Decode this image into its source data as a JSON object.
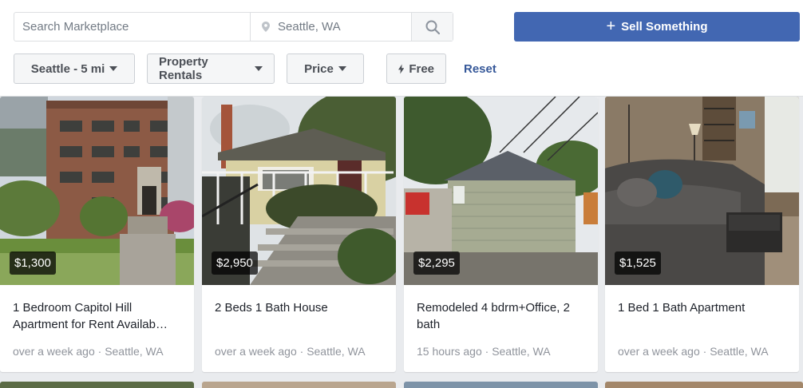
{
  "search": {
    "placeholder": "Search Marketplace",
    "location": "Seattle, WA"
  },
  "sell_button": "Sell Something",
  "filters": {
    "radius": "Seattle - 5 mi",
    "category": "Property Rentals",
    "price": "Price",
    "free": "Free",
    "reset": "Reset"
  },
  "listings": [
    {
      "price": "$1,300",
      "title": "1 Bedroom Capitol Hill Apartment for Rent Availab…",
      "time": "over a week ago",
      "location": "Seattle, WA"
    },
    {
      "price": "$2,950",
      "title": "2 Beds 1 Bath House",
      "time": "over a week ago",
      "location": "Seattle, WA"
    },
    {
      "price": "$2,295",
      "title": "Remodeled 4 bdrm+Office, 2 bath",
      "time": "15 hours ago",
      "location": "Seattle, WA"
    },
    {
      "price": "$1,525",
      "title": "1 Bed 1 Bath Apartment",
      "time": "over a week ago",
      "location": "Seattle, WA"
    }
  ],
  "meta_separator": "·",
  "colors": {
    "brand_blue": "#4267b2",
    "link_blue": "#365899",
    "background": "#e9ebee"
  }
}
